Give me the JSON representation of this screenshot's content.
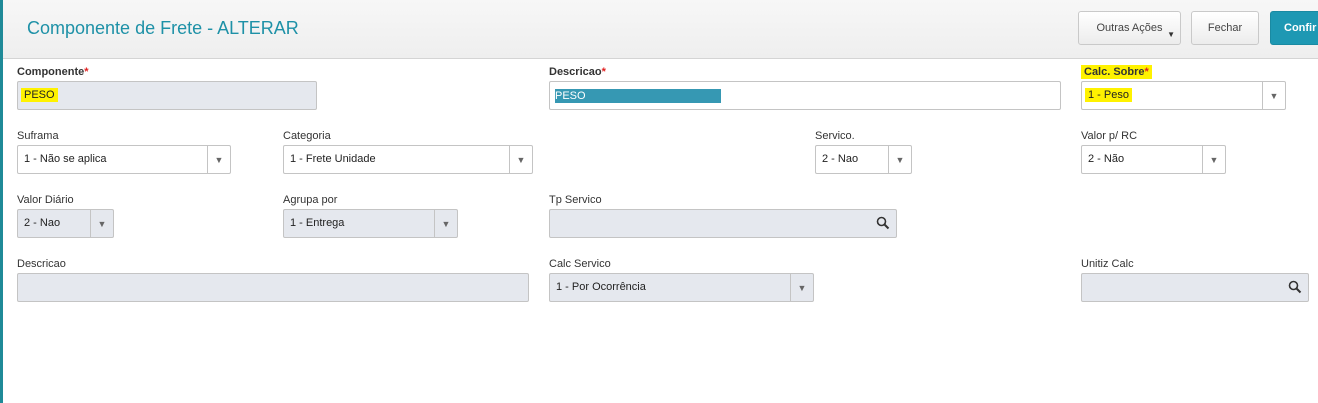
{
  "header": {
    "title": "Componente de Frete - ALTERAR",
    "buttons": {
      "other_actions": "Outras Ações",
      "close": "Fechar",
      "confirm": "Confir"
    }
  },
  "form": {
    "componente": {
      "label": "Componente",
      "value": "PESO",
      "required": "*"
    },
    "descricao_top": {
      "label": "Descricao",
      "value": "PESO",
      "required": "*"
    },
    "calc_sobre": {
      "label": "Calc. Sobre",
      "value": "1 - Peso",
      "required": "*"
    },
    "suframa": {
      "label": "Suframa",
      "value": "1 - Não se aplica"
    },
    "categoria": {
      "label": "Categoria",
      "value": "1 - Frete Unidade"
    },
    "servico": {
      "label": "Servico.",
      "value": "2 - Nao"
    },
    "valor_rc": {
      "label": "Valor p/ RC",
      "value": "2 - Não"
    },
    "valor_diario": {
      "label": "Valor Diário",
      "value": "2 - Nao"
    },
    "agrupa_por": {
      "label": "Agrupa por",
      "value": "1 - Entrega"
    },
    "tp_servico": {
      "label": "Tp Servico",
      "value": ""
    },
    "descricao": {
      "label": "Descricao",
      "value": ""
    },
    "calc_servico": {
      "label": "Calc Servico",
      "value": "1 - Por Ocorrência"
    },
    "unitiz_calc": {
      "label": "Unitiz Calc",
      "value": ""
    }
  },
  "icons": {
    "dropdown": "chevron-down-icon",
    "search": "search-icon"
  },
  "colors": {
    "accent": "#1e91a7",
    "primary_button": "#1e98b3",
    "highlight": "#fff200",
    "required": "#e02020"
  }
}
